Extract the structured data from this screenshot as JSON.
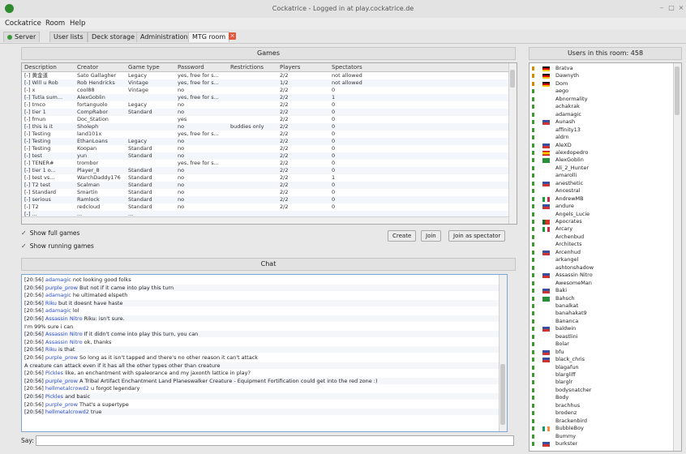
{
  "window": {
    "title": "Cockatrice - Logged in at play.cockatrice.de",
    "controls": [
      "–",
      "□",
      "×"
    ]
  },
  "menu": [
    "Cockatrice",
    "Room",
    "Help"
  ],
  "tabs": [
    {
      "label": "Server"
    },
    {
      "label": "User lists"
    },
    {
      "label": "Deck storage"
    },
    {
      "label": "Administration"
    },
    {
      "label": "MTG room"
    }
  ],
  "games": {
    "title": "Games",
    "columns": [
      "Description",
      "Creator",
      "Game type",
      "Password",
      "Restrictions",
      "Players",
      "Spectators"
    ],
    "rows": [
      [
        "[-] 黄金道",
        "Sato Gallagher",
        "Legacy",
        "yes, free for s...",
        "",
        "2/2",
        "not allowed"
      ],
      [
        "[-] Will u Rob",
        "Rob Hendricks",
        "Vintage",
        "yes, free for s...",
        "",
        "1/2",
        "not allowed"
      ],
      [
        "[-] x",
        "cool88",
        "Vintage",
        "no",
        "",
        "2/2",
        "0"
      ],
      [
        "[-] Tutla sum...",
        "AlexGoblin",
        "",
        "yes, free for s...",
        "",
        "2/2",
        "1"
      ],
      [
        "[-] tmco",
        "fortanguolo",
        "Legacy",
        "no",
        "",
        "2/2",
        "0"
      ],
      [
        "[-] tier 1",
        "CompRabor",
        "Standard",
        "no",
        "",
        "2/2",
        "0"
      ],
      [
        "[-] fmun",
        "Doc_Station",
        "",
        "yes",
        "",
        "2/2",
        "0"
      ],
      [
        "[-] this is it",
        "Sholeph",
        "",
        "no",
        "buddies only",
        "2/2",
        "0"
      ],
      [
        "[-] Testing",
        "land101x",
        "",
        "yes, free for s...",
        "",
        "2/2",
        "0"
      ],
      [
        "[-] Testing",
        "EthanLoans",
        "Legacy",
        "no",
        "",
        "2/2",
        "0"
      ],
      [
        "[-] Testing",
        "Koopan",
        "Standard",
        "no",
        "",
        "2/2",
        "0"
      ],
      [
        "[-] test",
        "yun",
        "Standard",
        "no",
        "",
        "2/2",
        "0"
      ],
      [
        "[-] TENER#",
        "trombor",
        "",
        "yes, free for s...",
        "",
        "2/2",
        "0"
      ],
      [
        "[-] tier 1 o...",
        "Player_8",
        "Standard",
        "no",
        "",
        "2/2",
        "0"
      ],
      [
        "[-] test vs...",
        "WarchDaddy176",
        "Standard",
        "no",
        "",
        "2/2",
        "1"
      ],
      [
        "[-] T2 test",
        "Scalman",
        "Standard",
        "no",
        "",
        "2/2",
        "0"
      ],
      [
        "[-] Standard",
        "Smartin",
        "Standard",
        "no",
        "",
        "2/2",
        "0"
      ],
      [
        "[-] serious",
        "Ramlock",
        "Standard",
        "no",
        "",
        "2/2",
        "0"
      ],
      [
        "[-] T2",
        "redcloud",
        "Standard",
        "no",
        "",
        "2/2",
        "0"
      ],
      [
        "[-] ...",
        "...",
        "...",
        "",
        "",
        "",
        ""
      ]
    ]
  },
  "options": {
    "show_full": "Show full games",
    "show_running": "Show running games"
  },
  "buttons": {
    "create": "Create",
    "join": "Join",
    "spectate": "Join as spectator"
  },
  "chat": {
    "title": "Chat",
    "say_label": "Say:",
    "lines": [
      {
        "time": "[20:56]",
        "user": "adamagic",
        "text": " not looking good folks"
      },
      {
        "time": "[20:56]",
        "user": "purple_prow",
        "text": " But not if it came into play this turn"
      },
      {
        "time": "[20:56]",
        "user": "adamagic",
        "text": " he ultimated elspeth"
      },
      {
        "time": "[20:56]",
        "user": "Riku",
        "text": " but it doesnt have haste"
      },
      {
        "time": "[20:56]",
        "user": "adamagic",
        "text": " lol"
      },
      {
        "time": "[20:56]",
        "user": "Assassin Nitro",
        "text": " Riku: isn't sure."
      },
      {
        "time": "",
        "user": "",
        "text": "    I'm 99% sure i can"
      },
      {
        "time": "[20:56]",
        "user": "Assassin Nitro",
        "text": " If it didn't come into play this turn, you can"
      },
      {
        "time": "[20:56]",
        "user": "Assassin Nitro",
        "text": " ok, thanks"
      },
      {
        "time": "[20:56]",
        "user": "Riku",
        "text": " is that"
      },
      {
        "time": "[20:56]",
        "user": "purple_prow",
        "text": " So long as it isn't tapped and there's no other reason it can't attack"
      },
      {
        "time": "",
        "user": "",
        "text": "    A creature can attack even if it has all the other types other than creature"
      },
      {
        "time": "[20:56]",
        "user": "Pickles",
        "text": " like, an enchantment with spaleorance and my jaxonth lattice in play?"
      },
      {
        "time": "[20:56]",
        "user": "purple_prow",
        "text": " A Tribal Artifact Enchantment Land Planeswalker Creature - Equipment Fortification could get into the red zone :)"
      },
      {
        "time": "[20:56]",
        "user": "hellmetalcrowd2",
        "text": " u forgot legendary"
      },
      {
        "time": "[20:56]",
        "user": "Pickles",
        "text": " and basic"
      },
      {
        "time": "[20:56]",
        "user": "purple_prow",
        "text": " That's a supertype"
      },
      {
        "time": "[20:56]",
        "user": "hellmetalcrowd2",
        "text": " true"
      }
    ]
  },
  "users": {
    "title": "Users in this room: 458",
    "list": [
      {
        "name": "Bratva",
        "flag": "de",
        "status": "judge"
      },
      {
        "name": "Dawnyth",
        "flag": "de",
        "status": "judge"
      },
      {
        "name": "Dom",
        "flag": "de",
        "status": "mod"
      },
      {
        "name": "aego",
        "flag": "",
        "status": "reg"
      },
      {
        "name": "Abnormality",
        "flag": "",
        "status": "reg"
      },
      {
        "name": "achakrak",
        "flag": "",
        "status": "reg"
      },
      {
        "name": "adamagic",
        "flag": "",
        "status": "reg"
      },
      {
        "name": "Aunash",
        "flag": "us",
        "status": "reg"
      },
      {
        "name": "affinity13",
        "flag": "",
        "status": "reg"
      },
      {
        "name": "aldrn",
        "flag": "",
        "status": "reg"
      },
      {
        "name": "AleXD",
        "flag": "us",
        "status": "reg"
      },
      {
        "name": "alexdopedro",
        "flag": "es",
        "status": "reg"
      },
      {
        "name": "AlexGoblin",
        "flag": "br",
        "status": "reg"
      },
      {
        "name": "Ali_2_Hunter",
        "flag": "",
        "status": "reg"
      },
      {
        "name": "amarolli",
        "flag": "",
        "status": "reg"
      },
      {
        "name": "anesthetic",
        "flag": "us",
        "status": "reg"
      },
      {
        "name": "Ancestral",
        "flag": "",
        "status": "reg"
      },
      {
        "name": "AndrewMB",
        "flag": "it",
        "status": "reg"
      },
      {
        "name": "andure",
        "flag": "us",
        "status": "reg"
      },
      {
        "name": "Angels_Lucie",
        "flag": "",
        "status": "reg"
      },
      {
        "name": "Apocrates",
        "flag": "pt",
        "status": "reg"
      },
      {
        "name": "Arcary",
        "flag": "it",
        "status": "reg"
      },
      {
        "name": "Archenbud",
        "flag": "",
        "status": "reg"
      },
      {
        "name": "Architects",
        "flag": "",
        "status": "reg"
      },
      {
        "name": "Arcenhud",
        "flag": "us",
        "status": "reg"
      },
      {
        "name": "arkangel",
        "flag": "",
        "status": "reg"
      },
      {
        "name": "ashtonshadow",
        "flag": "",
        "status": "reg"
      },
      {
        "name": "Assassin Nitro",
        "flag": "us",
        "status": "reg"
      },
      {
        "name": "AwesomeMan",
        "flag": "",
        "status": "reg"
      },
      {
        "name": "Baki",
        "flag": "us",
        "status": "reg"
      },
      {
        "name": "Bahsch",
        "flag": "br",
        "status": "reg"
      },
      {
        "name": "banalkat",
        "flag": "",
        "status": "reg"
      },
      {
        "name": "banahakat9",
        "flag": "",
        "status": "reg"
      },
      {
        "name": "Bananca",
        "flag": "",
        "status": "reg"
      },
      {
        "name": "baldwin",
        "flag": "us",
        "status": "reg"
      },
      {
        "name": "beastlini",
        "flag": "",
        "status": "reg"
      },
      {
        "name": "Bolar",
        "flag": "",
        "status": "reg"
      },
      {
        "name": "bfu",
        "flag": "us",
        "status": "reg"
      },
      {
        "name": "black_chris",
        "flag": "us",
        "status": "reg"
      },
      {
        "name": "blagafun",
        "flag": "",
        "status": "reg"
      },
      {
        "name": "blargliff",
        "flag": "",
        "status": "reg"
      },
      {
        "name": "blarglr",
        "flag": "",
        "status": "reg"
      },
      {
        "name": "bodysnatcher",
        "flag": "",
        "status": "reg"
      },
      {
        "name": "Body",
        "flag": "",
        "status": "reg"
      },
      {
        "name": "brachhus",
        "flag": "",
        "status": "reg"
      },
      {
        "name": "brodenz",
        "flag": "",
        "status": "reg"
      },
      {
        "name": "Brackenbird",
        "flag": "",
        "status": "reg"
      },
      {
        "name": "BubbleBoy",
        "flag": "ie",
        "status": "reg"
      },
      {
        "name": "Bummy",
        "flag": "",
        "status": "reg"
      },
      {
        "name": "burkster",
        "flag": "us",
        "status": "reg"
      }
    ]
  },
  "colors": {
    "accent": "#2b4ccf",
    "status_reg": "#3b9a2e",
    "status_judge": "#d28a00",
    "close_tab": "#e2573c"
  }
}
